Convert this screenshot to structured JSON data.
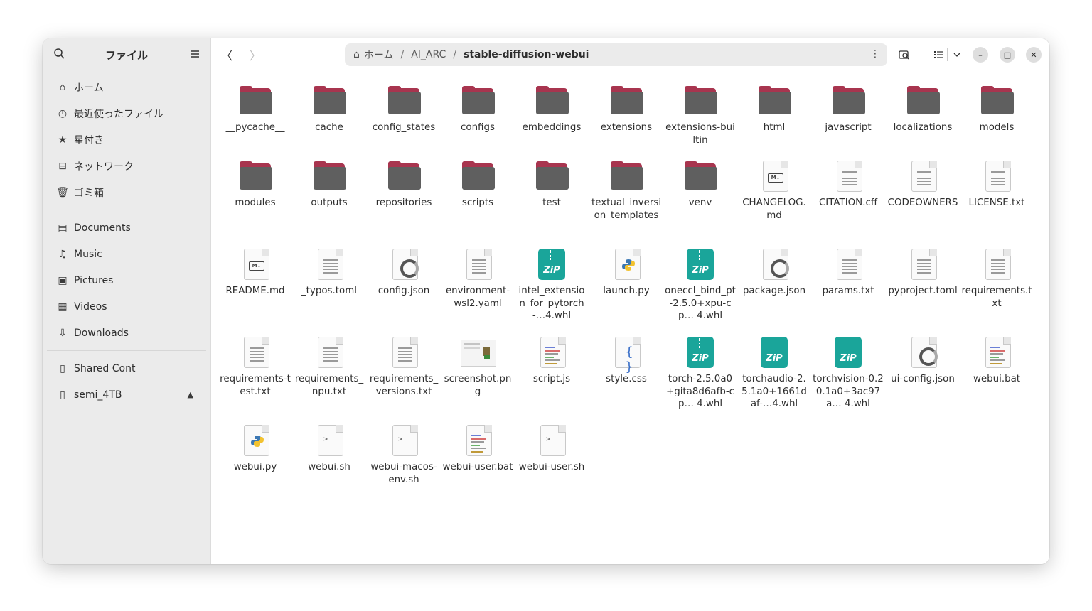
{
  "sidebar": {
    "title": "ファイル",
    "places": [
      {
        "label": "ホーム",
        "icon": "home-icon"
      },
      {
        "label": "最近使ったファイル",
        "icon": "clock-icon"
      },
      {
        "label": "星付き",
        "icon": "star-icon"
      },
      {
        "label": "ネットワーク",
        "icon": "network-icon"
      },
      {
        "label": "ゴミ箱",
        "icon": "trash-icon"
      }
    ],
    "bookmarks": [
      {
        "label": "Documents",
        "icon": "document-icon"
      },
      {
        "label": "Music",
        "icon": "music-icon"
      },
      {
        "label": "Pictures",
        "icon": "picture-icon"
      },
      {
        "label": "Videos",
        "icon": "video-icon"
      },
      {
        "label": "Downloads",
        "icon": "download-icon"
      }
    ],
    "devices": [
      {
        "label": "Shared Cont",
        "icon": "drive-icon"
      },
      {
        "label": "semi_4TB",
        "icon": "drive-icon"
      }
    ]
  },
  "path": {
    "home": "ホーム",
    "parent": "AI_ARC",
    "current": "stable-diffusion-webui"
  },
  "files": [
    {
      "name": "__pycache__",
      "type": "folder"
    },
    {
      "name": "cache",
      "type": "folder"
    },
    {
      "name": "config_states",
      "type": "folder"
    },
    {
      "name": "configs",
      "type": "folder"
    },
    {
      "name": "embeddings",
      "type": "folder"
    },
    {
      "name": "extensions",
      "type": "folder"
    },
    {
      "name": "extensions-builtin",
      "type": "folder"
    },
    {
      "name": "html",
      "type": "folder"
    },
    {
      "name": "javascript",
      "type": "folder"
    },
    {
      "name": "localizations",
      "type": "folder"
    },
    {
      "name": "models",
      "type": "folder"
    },
    {
      "name": "modules",
      "type": "folder"
    },
    {
      "name": "outputs",
      "type": "folder"
    },
    {
      "name": "repositories",
      "type": "folder"
    },
    {
      "name": "scripts",
      "type": "folder"
    },
    {
      "name": "test",
      "type": "folder"
    },
    {
      "name": "textual_inversion_templates",
      "type": "folder"
    },
    {
      "name": "venv",
      "type": "folder"
    },
    {
      "name": "CHANGELOG.md",
      "type": "md"
    },
    {
      "name": "CITATION.cff",
      "type": "text"
    },
    {
      "name": "CODEOWNERS",
      "type": "text"
    },
    {
      "name": "LICENSE.txt",
      "type": "text"
    },
    {
      "name": "README.md",
      "type": "md"
    },
    {
      "name": "_typos.toml",
      "type": "text"
    },
    {
      "name": "config.json",
      "type": "json"
    },
    {
      "name": "environment-wsl2.yaml",
      "type": "text"
    },
    {
      "name": "intel_extension_for_pytorch-…4.whl",
      "type": "zip"
    },
    {
      "name": "launch.py",
      "type": "python"
    },
    {
      "name": "oneccl_bind_pt-2.5.0+xpu-cp… 4.whl",
      "type": "zip"
    },
    {
      "name": "package.json",
      "type": "json"
    },
    {
      "name": "params.txt",
      "type": "text"
    },
    {
      "name": "pyproject.toml",
      "type": "text"
    },
    {
      "name": "requirements.txt",
      "type": "text"
    },
    {
      "name": "requirements-test.txt",
      "type": "text"
    },
    {
      "name": "requirements_npu.txt",
      "type": "text"
    },
    {
      "name": "requirements_versions.txt",
      "type": "text"
    },
    {
      "name": "screenshot.png",
      "type": "image"
    },
    {
      "name": "script.js",
      "type": "code"
    },
    {
      "name": "style.css",
      "type": "css"
    },
    {
      "name": "torch-2.5.0a0+gita8d6afb-cp… 4.whl",
      "type": "zip"
    },
    {
      "name": "torchaudio-2.5.1a0+1661daf-…4.whl",
      "type": "zip"
    },
    {
      "name": "torchvision-0.20.1a0+3ac97a… 4.whl",
      "type": "zip"
    },
    {
      "name": "ui-config.json",
      "type": "json"
    },
    {
      "name": "webui.bat",
      "type": "code"
    },
    {
      "name": "webui.py",
      "type": "python"
    },
    {
      "name": "webui.sh",
      "type": "shell"
    },
    {
      "name": "webui-macos-env.sh",
      "type": "shell"
    },
    {
      "name": "webui-user.bat",
      "type": "code"
    },
    {
      "name": "webui-user.sh",
      "type": "shell"
    }
  ],
  "colors": {
    "folder_tab": "#a8354f",
    "folder_body": "#5f5f5f",
    "zip": "#1aa59a",
    "sidebar_bg": "#ebebeb"
  }
}
